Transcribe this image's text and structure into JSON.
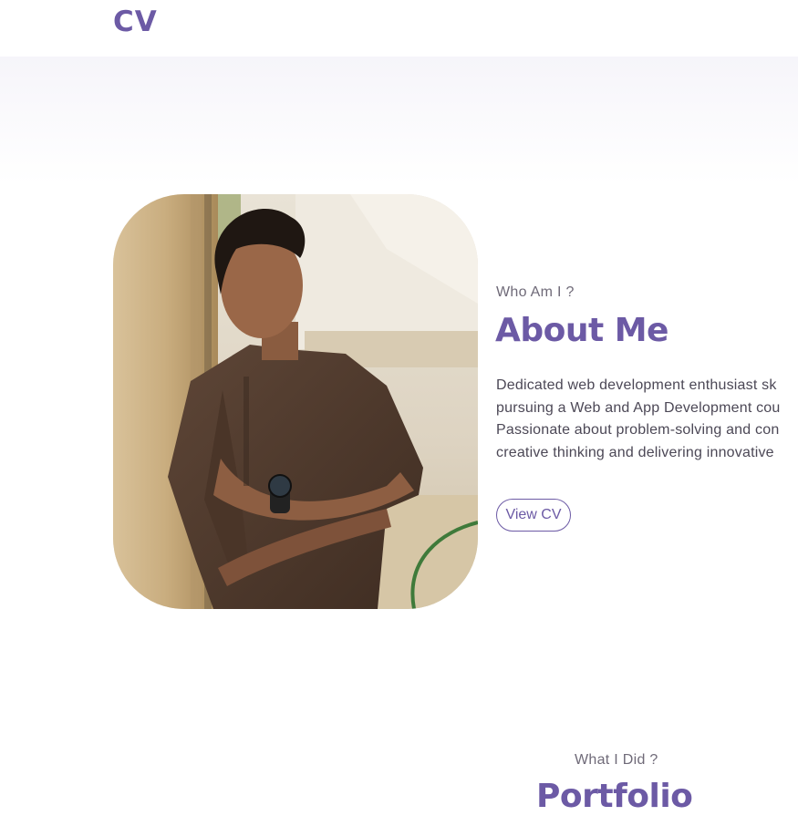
{
  "nav": {
    "logo": "CV"
  },
  "about": {
    "eyebrow": "Who Am I ?",
    "title": "About Me",
    "bio_lines": [
      "Dedicated web development enthusiast sk",
      "pursuing a Web and App Development cou",
      "Passionate about problem-solving and con",
      "creative thinking and delivering innovative"
    ],
    "cta": "View CV",
    "photo_alt": "profile-photo"
  },
  "portfolio": {
    "eyebrow": "What I Did ?",
    "title": "Portfolio"
  },
  "colors": {
    "accent": "#6c5aa5",
    "muted_text": "#6f6a78",
    "body_text": "#4c4856"
  }
}
